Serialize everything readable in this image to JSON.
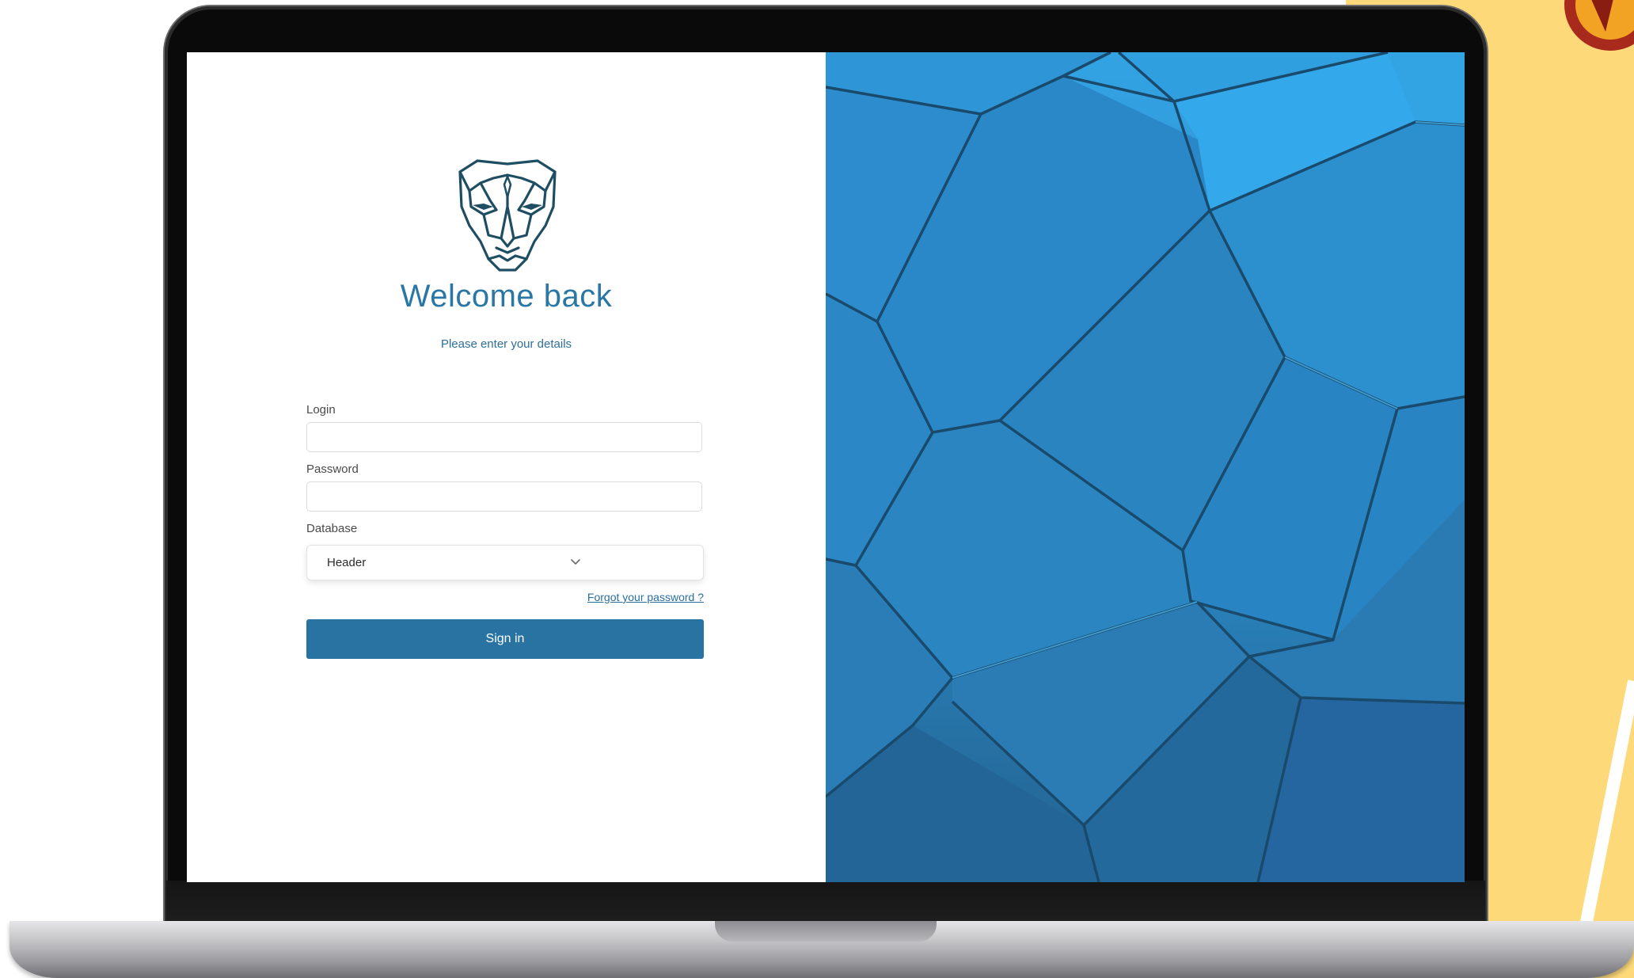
{
  "login_page": {
    "title": "Welcome back",
    "subtitle": "Please enter your details",
    "login": {
      "label": "Login",
      "value": ""
    },
    "password": {
      "label": "Password",
      "value": ""
    },
    "database": {
      "label": "Database",
      "selected": "Header"
    },
    "forgot_link": "Forgot your password ?",
    "signin_label": "Sign in",
    "logo_icon": "panther-head-icon",
    "colors": {
      "accent": "#2873a2",
      "title": "#2a77a6",
      "right_panel": "#2a86c4",
      "backdrop": "#fdd97a"
    }
  }
}
